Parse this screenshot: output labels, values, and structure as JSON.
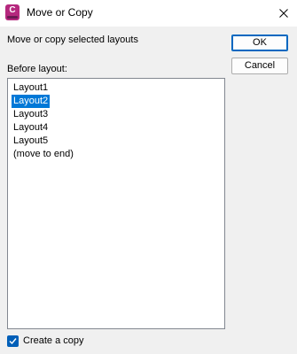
{
  "window": {
    "title": "Move or Copy",
    "app_icon_letter": "C"
  },
  "dialog": {
    "description": "Move or copy selected layouts",
    "list_label": "Before layout:",
    "layouts": [
      {
        "label": "Layout1",
        "selected": false
      },
      {
        "label": "Layout2",
        "selected": true
      },
      {
        "label": "Layout3",
        "selected": false
      },
      {
        "label": "Layout4",
        "selected": false
      },
      {
        "label": "Layout5",
        "selected": false
      },
      {
        "label": "(move to end)",
        "selected": false
      }
    ],
    "create_copy": {
      "label": "Create a copy",
      "checked": true
    }
  },
  "buttons": {
    "ok_label": "OK",
    "cancel_label": "Cancel"
  },
  "colors": {
    "selection": "#0078d7",
    "checkbox": "#005fb8",
    "app_icon": "#b5287e"
  }
}
